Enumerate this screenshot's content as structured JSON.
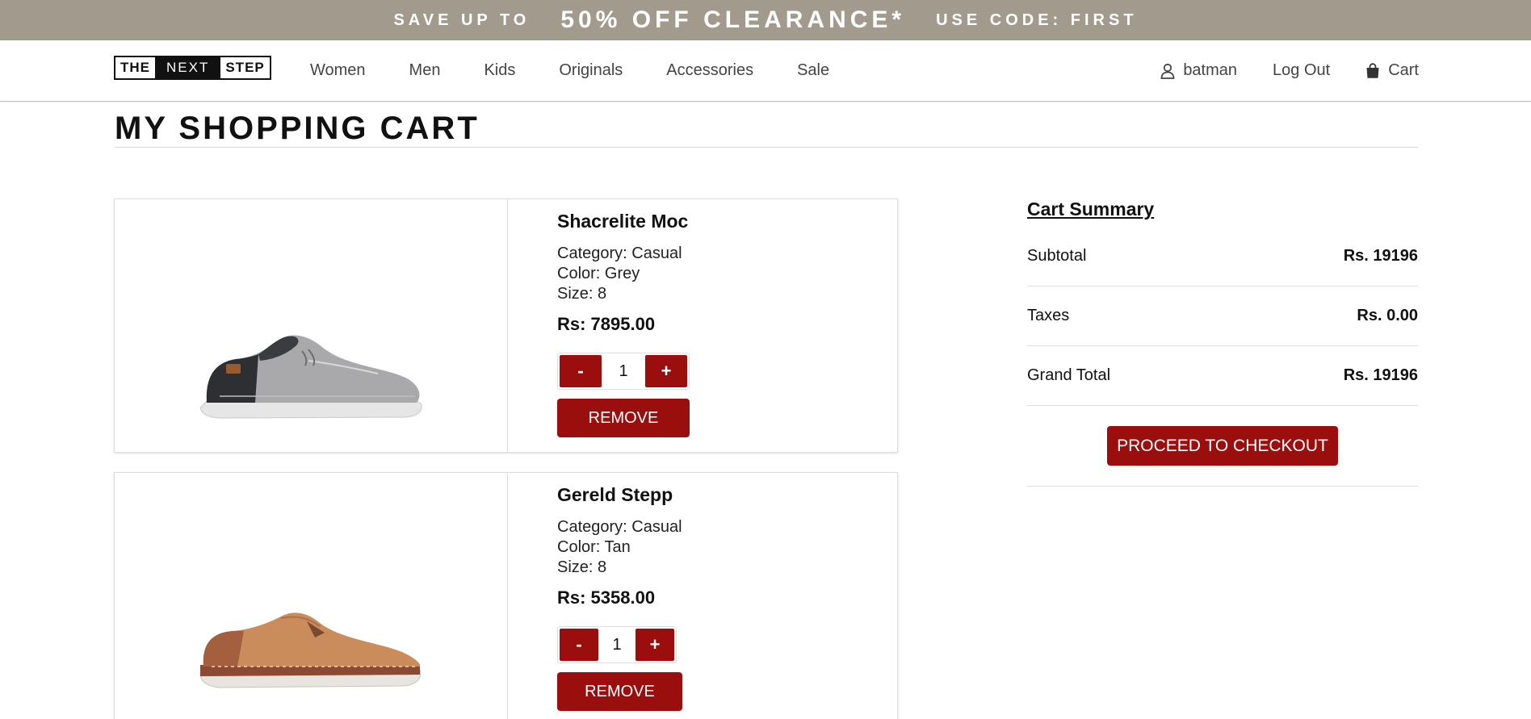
{
  "promo": {
    "lead": "SAVE UP TO",
    "headline": "50% OFF CLEARANCE*",
    "code": "USE CODE: FIRST"
  },
  "logo": {
    "part1": "THE",
    "part2": "NEXT",
    "part3": "STEP"
  },
  "nav": [
    "Women",
    "Men",
    "Kids",
    "Originals",
    "Accessories",
    "Sale"
  ],
  "account": {
    "username": "batman",
    "logout": "Log Out",
    "cart": "Cart"
  },
  "page": {
    "title": "MY SHOPPING CART"
  },
  "items": [
    {
      "name": "Shacrelite Moc",
      "category": "Category: Casual",
      "color": "Color: Grey",
      "size": "Size: 8",
      "price": "Rs: 7895.00",
      "quantity": "1",
      "minus": "-",
      "plus": "+",
      "remove": "REMOVE"
    },
    {
      "name": "Gereld Stepp",
      "category": "Category: Casual",
      "color": "Color: Tan",
      "size": "Size: 8",
      "price": "Rs: 5358.00",
      "quantity": "1",
      "minus": "-",
      "plus": "+",
      "remove": "REMOVE"
    }
  ],
  "summary": {
    "heading": "Cart Summary",
    "rows": [
      {
        "label": "Subtotal",
        "value": "Rs. 19196"
      },
      {
        "label": "Taxes",
        "value": "Rs. 0.00"
      },
      {
        "label": "Grand Total",
        "value": "Rs. 19196"
      }
    ],
    "checkout": "PROCEED TO CHECKOUT"
  },
  "colors": {
    "accent": "#9b0e0e",
    "banner": "#a39a8e"
  },
  "icons": {
    "user": "user-icon",
    "cart": "shopping-bag-icon"
  }
}
